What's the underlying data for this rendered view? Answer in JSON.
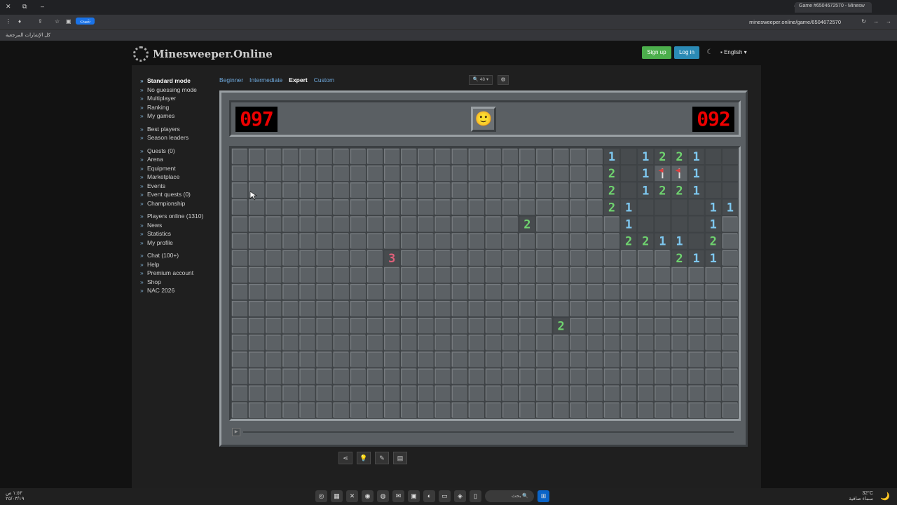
{
  "browser": {
    "tab_title": "Game #6504672570 - Minesw",
    "url": "minesweeper.online/game/6504672570",
    "install_label": "تثبيت",
    "bookmarks_label": "كل الإشارات المرجعية"
  },
  "site": {
    "logo_text": "Minesweeper.Online",
    "signup_label": "Sign up",
    "login_label": "Log in",
    "language_label": "English"
  },
  "sidebar": {
    "groups": [
      [
        "Standard mode",
        "No guessing mode",
        "Multiplayer",
        "Ranking",
        "My games"
      ],
      [
        "Best players",
        "Season leaders"
      ],
      [
        "Quests (0)",
        "Arena",
        "Equipment",
        "Marketplace",
        "Events",
        "Event quests (0)",
        "Championship"
      ],
      [
        "Players online (1310)",
        "News",
        "Statistics",
        "My profile"
      ],
      [
        "Chat (100+)",
        "Help",
        "Premium account",
        "Shop",
        "NAC 2026"
      ]
    ]
  },
  "difficulty_tabs": [
    "Beginner",
    "Intermediate",
    "Expert",
    "Custom"
  ],
  "active_difficulty": "Expert",
  "zoom_label": "48",
  "game": {
    "mine_counter": "097",
    "timer": "092",
    "face": "🙂",
    "rows": 16,
    "cols": 30,
    "cells": [
      [
        "#",
        "#",
        "#",
        "#",
        "#",
        "#",
        "#",
        "#",
        "#",
        "#",
        "#",
        "#",
        "#",
        "#",
        "#",
        "#",
        "#",
        "#",
        "#",
        "#",
        "#",
        "#",
        "1",
        "0",
        "1",
        "2",
        "2",
        "1",
        "0",
        "0"
      ],
      [
        "#",
        "#",
        "#",
        "#",
        "#",
        "#",
        "#",
        "#",
        "#",
        "#",
        "#",
        "#",
        "#",
        "#",
        "#",
        "#",
        "#",
        "#",
        "#",
        "#",
        "#",
        "#",
        "2",
        "0",
        "1",
        "f",
        "f",
        "1",
        "0",
        "0"
      ],
      [
        "#",
        "#",
        "#",
        "#",
        "#",
        "#",
        "#",
        "#",
        "#",
        "#",
        "#",
        "#",
        "#",
        "#",
        "#",
        "#",
        "#",
        "#",
        "#",
        "#",
        "#",
        "#",
        "2",
        "0",
        "1",
        "2",
        "2",
        "1",
        "0",
        "0"
      ],
      [
        "#",
        "#",
        "#",
        "#",
        "#",
        "#",
        "#",
        "#",
        "#",
        "#",
        "#",
        "#",
        "#",
        "#",
        "#",
        "#",
        "#",
        "#",
        "#",
        "#",
        "#",
        "#",
        "2",
        "1",
        "0",
        "0",
        "0",
        "0",
        "1",
        "1"
      ],
      [
        "#",
        "#",
        "#",
        "#",
        "#",
        "#",
        "#",
        "#",
        "#",
        "#",
        "#",
        "#",
        "#",
        "#",
        "#",
        "#",
        "#",
        "2",
        "#",
        "#",
        "#",
        "#",
        "#",
        "1",
        "0",
        "0",
        "0",
        "0",
        "1",
        "#"
      ],
      [
        "#",
        "#",
        "#",
        "#",
        "#",
        "#",
        "#",
        "#",
        "#",
        "#",
        "#",
        "#",
        "#",
        "#",
        "#",
        "#",
        "#",
        "#",
        "#",
        "#",
        "#",
        "#",
        "#",
        "2",
        "2",
        "1",
        "1",
        "0",
        "2",
        "#"
      ],
      [
        "#",
        "#",
        "#",
        "#",
        "#",
        "#",
        "#",
        "#",
        "#",
        "3",
        "#",
        "#",
        "#",
        "#",
        "#",
        "#",
        "#",
        "#",
        "#",
        "#",
        "#",
        "#",
        "#",
        "#",
        "#",
        "#",
        "2",
        "1",
        "1",
        "#"
      ],
      [
        "#",
        "#",
        "#",
        "#",
        "#",
        "#",
        "#",
        "#",
        "#",
        "#",
        "#",
        "#",
        "#",
        "#",
        "#",
        "#",
        "#",
        "#",
        "#",
        "#",
        "#",
        "#",
        "#",
        "#",
        "#",
        "#",
        "#",
        "#",
        "#",
        "#"
      ],
      [
        "#",
        "#",
        "#",
        "#",
        "#",
        "#",
        "#",
        "#",
        "#",
        "#",
        "#",
        "#",
        "#",
        "#",
        "#",
        "#",
        "#",
        "#",
        "#",
        "#",
        "#",
        "#",
        "#",
        "#",
        "#",
        "#",
        "#",
        "#",
        "#",
        "#"
      ],
      [
        "#",
        "#",
        "#",
        "#",
        "#",
        "#",
        "#",
        "#",
        "#",
        "#",
        "#",
        "#",
        "#",
        "#",
        "#",
        "#",
        "#",
        "#",
        "#",
        "#",
        "#",
        "#",
        "#",
        "#",
        "#",
        "#",
        "#",
        "#",
        "#",
        "#"
      ],
      [
        "#",
        "#",
        "#",
        "#",
        "#",
        "#",
        "#",
        "#",
        "#",
        "#",
        "#",
        "#",
        "#",
        "#",
        "#",
        "#",
        "#",
        "#",
        "#",
        "2",
        "#",
        "#",
        "#",
        "#",
        "#",
        "#",
        "#",
        "#",
        "#",
        "#"
      ],
      [
        "#",
        "#",
        "#",
        "#",
        "#",
        "#",
        "#",
        "#",
        "#",
        "#",
        "#",
        "#",
        "#",
        "#",
        "#",
        "#",
        "#",
        "#",
        "#",
        "#",
        "#",
        "#",
        "#",
        "#",
        "#",
        "#",
        "#",
        "#",
        "#",
        "#"
      ],
      [
        "#",
        "#",
        "#",
        "#",
        "#",
        "#",
        "#",
        "#",
        "#",
        "#",
        "#",
        "#",
        "#",
        "#",
        "#",
        "#",
        "#",
        "#",
        "#",
        "#",
        "#",
        "#",
        "#",
        "#",
        "#",
        "#",
        "#",
        "#",
        "#",
        "#"
      ],
      [
        "#",
        "#",
        "#",
        "#",
        "#",
        "#",
        "#",
        "#",
        "#",
        "#",
        "#",
        "#",
        "#",
        "#",
        "#",
        "#",
        "#",
        "#",
        "#",
        "#",
        "#",
        "#",
        "#",
        "#",
        "#",
        "#",
        "#",
        "#",
        "#",
        "#"
      ],
      [
        "#",
        "#",
        "#",
        "#",
        "#",
        "#",
        "#",
        "#",
        "#",
        "#",
        "#",
        "#",
        "#",
        "#",
        "#",
        "#",
        "#",
        "#",
        "#",
        "#",
        "#",
        "#",
        "#",
        "#",
        "#",
        "#",
        "#",
        "#",
        "#",
        "#"
      ],
      [
        "#",
        "#",
        "#",
        "#",
        "#",
        "#",
        "#",
        "#",
        "#",
        "#",
        "#",
        "#",
        "#",
        "#",
        "#",
        "#",
        "#",
        "#",
        "#",
        "#",
        "#",
        "#",
        "#",
        "#",
        "#",
        "#",
        "#",
        "#",
        "#",
        "#"
      ]
    ],
    "number_colors": {
      "1": "#7ec8f0",
      "2": "#6fd36f",
      "3": "#e0607a"
    },
    "flag_color": "#e04040"
  },
  "bottom_tools": [
    "share-icon",
    "lightbulb-icon",
    "edit-icon",
    "image-icon"
  ],
  "taskbar": {
    "search_label": "بحث",
    "weather_temp": "32°C",
    "weather_desc": "سماء صافية",
    "time": "١:٥٣ ص",
    "date": "٢٥/٠٣/١٩"
  }
}
